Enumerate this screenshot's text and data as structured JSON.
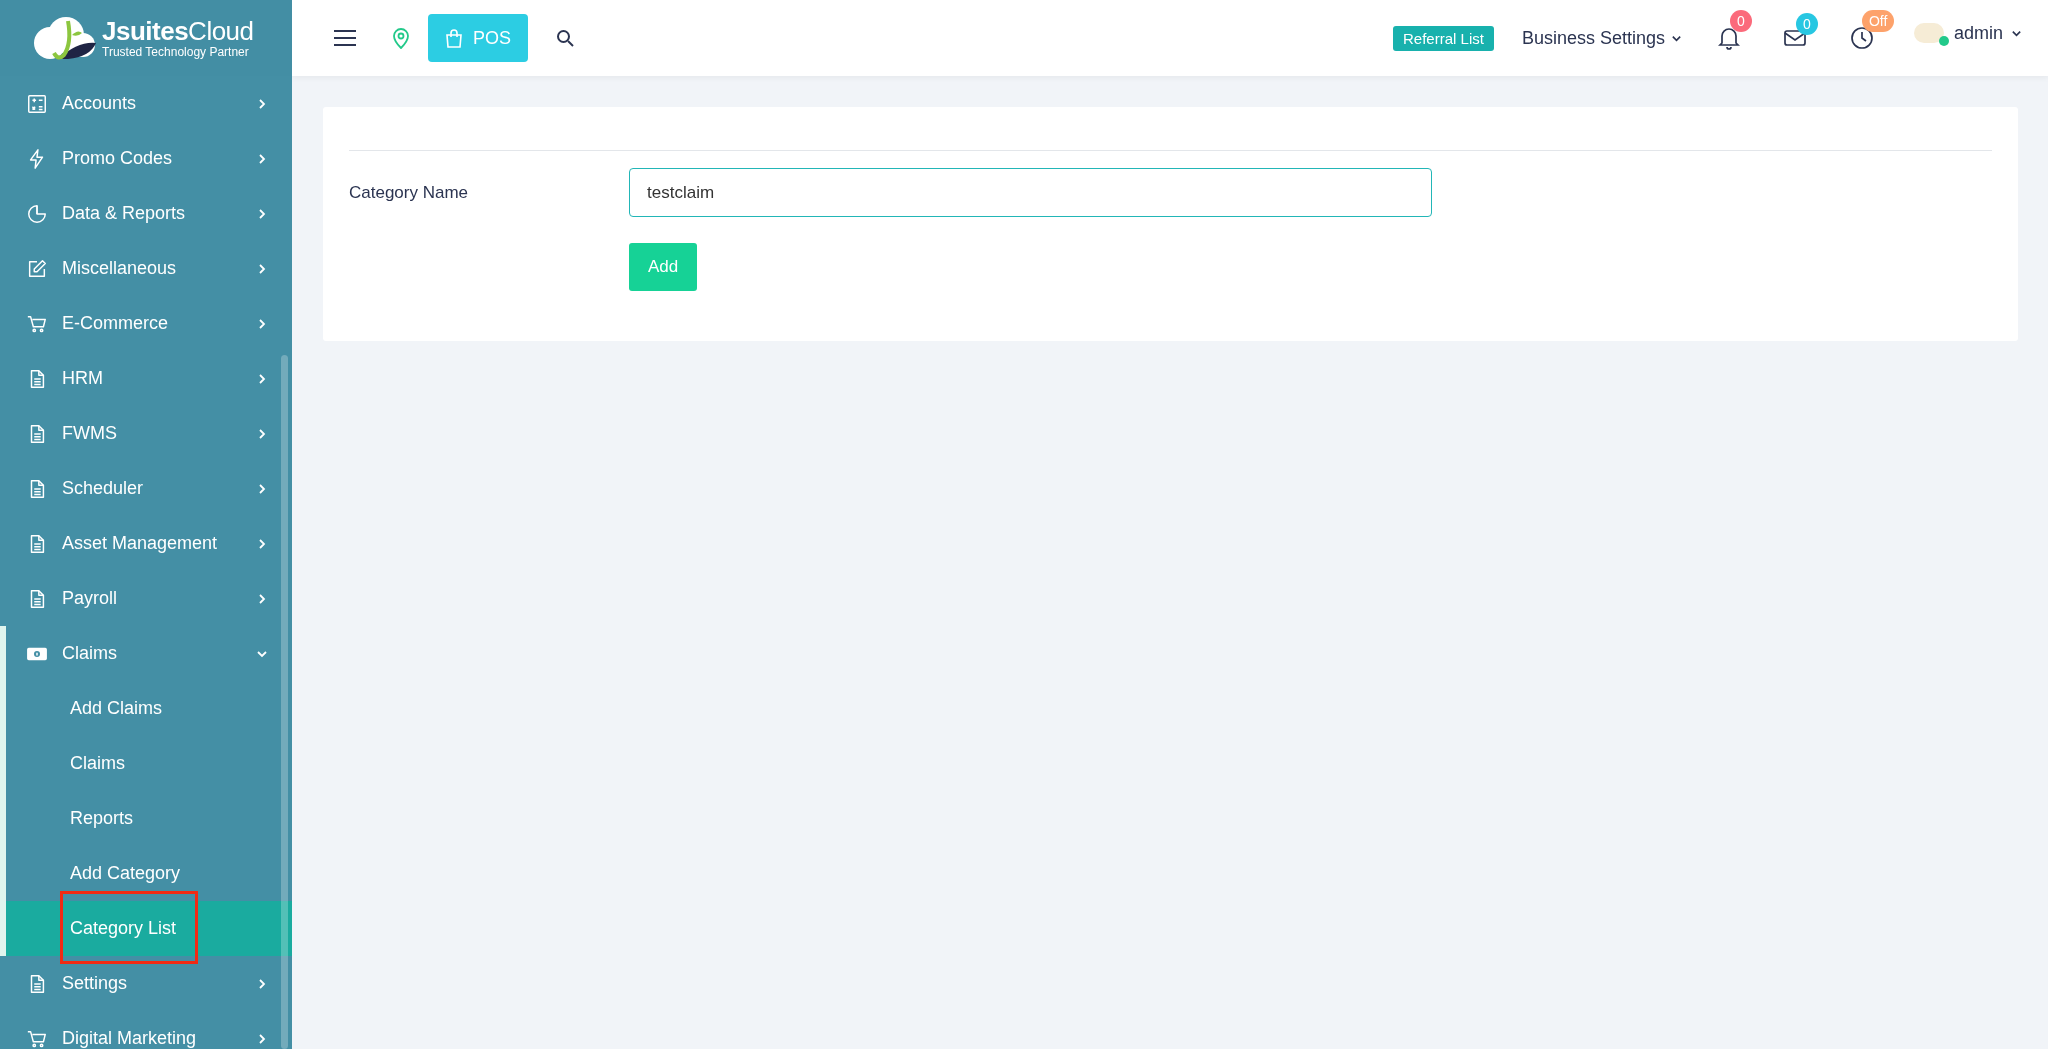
{
  "logo": {
    "name": "**Jsuites**Cloud",
    "tagline": "Trusted Technology Partner"
  },
  "sidebar": {
    "items": [
      {
        "label": "Accounts",
        "kind": "calculator",
        "expanded": false
      },
      {
        "label": "Promo Codes",
        "kind": "bolt",
        "expanded": false
      },
      {
        "label": "Data & Reports",
        "kind": "pie",
        "expanded": false
      },
      {
        "label": "Miscellaneous",
        "kind": "edit",
        "expanded": false
      },
      {
        "label": "E-Commerce",
        "kind": "cart",
        "expanded": false
      },
      {
        "label": "HRM",
        "kind": "document",
        "expanded": false
      },
      {
        "label": "FWMS",
        "kind": "document",
        "expanded": false
      },
      {
        "label": "Scheduler",
        "kind": "document",
        "expanded": false
      },
      {
        "label": "Asset Management",
        "kind": "document",
        "expanded": false
      },
      {
        "label": "Payroll",
        "kind": "document",
        "expanded": false
      },
      {
        "label": "Claims",
        "kind": "money",
        "expanded": true,
        "children": [
          {
            "label": "Add Claims",
            "selected": false,
            "annotated": false
          },
          {
            "label": "Claims",
            "selected": false,
            "annotated": false
          },
          {
            "label": "Reports",
            "selected": false,
            "annotated": false
          },
          {
            "label": "Add Category",
            "selected": false,
            "annotated": false
          },
          {
            "label": "Category List",
            "selected": true,
            "annotated": true
          }
        ]
      },
      {
        "label": "Settings",
        "kind": "document",
        "expanded": false
      },
      {
        "label": "Digital Marketing",
        "kind": "cart",
        "expanded": false
      }
    ]
  },
  "topbar": {
    "pos_button": "POS",
    "referral_button": "Referral List",
    "business_settings": "Business Settings",
    "notifications_count": "0",
    "messages_count": "0",
    "clock_status": "Off",
    "user": {
      "name": "admin",
      "online": true
    }
  },
  "form": {
    "label": "Category Name",
    "value": "testclaim",
    "submit": "Add"
  }
}
